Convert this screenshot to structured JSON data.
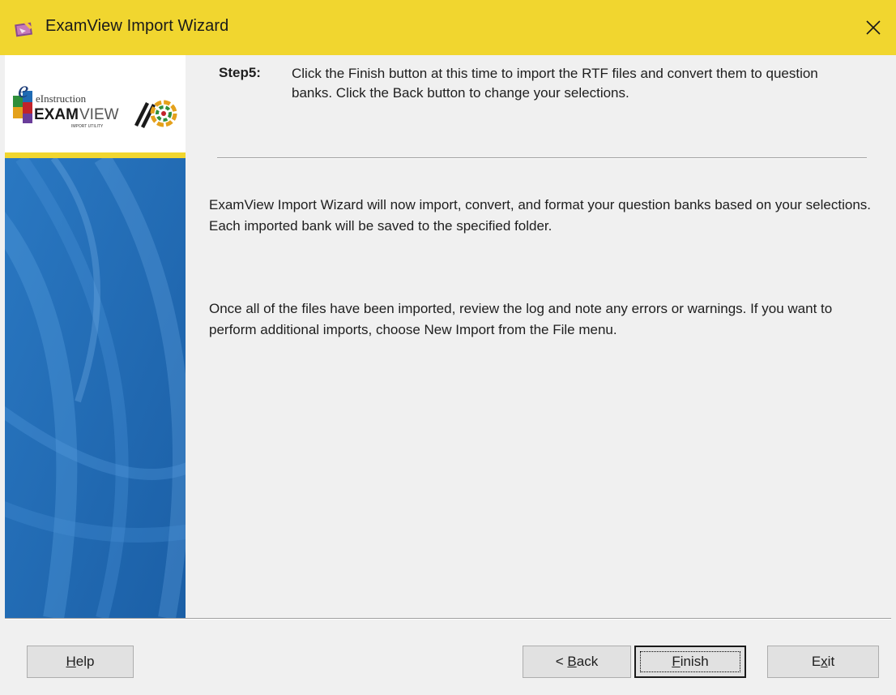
{
  "window": {
    "title": "ExamView Import Wizard",
    "titlebar_color": "#f1d62f",
    "close_icon": "close-icon",
    "app_icon": "examview-app-icon"
  },
  "sidebar": {
    "logo": {
      "brand_small": "eInstruction",
      "brand_main_bold": "EXAM",
      "brand_main_light": "VIEW",
      "tagline": "IMPORT UTILITY"
    },
    "accent_color": "#f1d62f",
    "panel_color": "#1f6bb4"
  },
  "step": {
    "label": "Step5:",
    "text": "Click the Finish button at this time to import the RTF files and convert them to question banks.  Click the Back button to change your selections."
  },
  "body": {
    "paragraph1": "ExamView Import Wizard will now import,  convert, and format your question banks based on your selections.  Each imported bank will be saved to the specified folder.",
    "paragraph2": "Once all of the files have been imported, review the log and note any errors or warnings.  If you want to perform additional imports, choose New Import from the File menu."
  },
  "buttons": {
    "help": {
      "mnemonic": "H",
      "rest": "elp"
    },
    "back": {
      "prefix": "< ",
      "mnemonic": "B",
      "rest": "ack"
    },
    "finish": {
      "mnemonic": "F",
      "rest": "inish"
    },
    "exit": {
      "first": "E",
      "mnemonic": "x",
      "rest": "it"
    }
  }
}
